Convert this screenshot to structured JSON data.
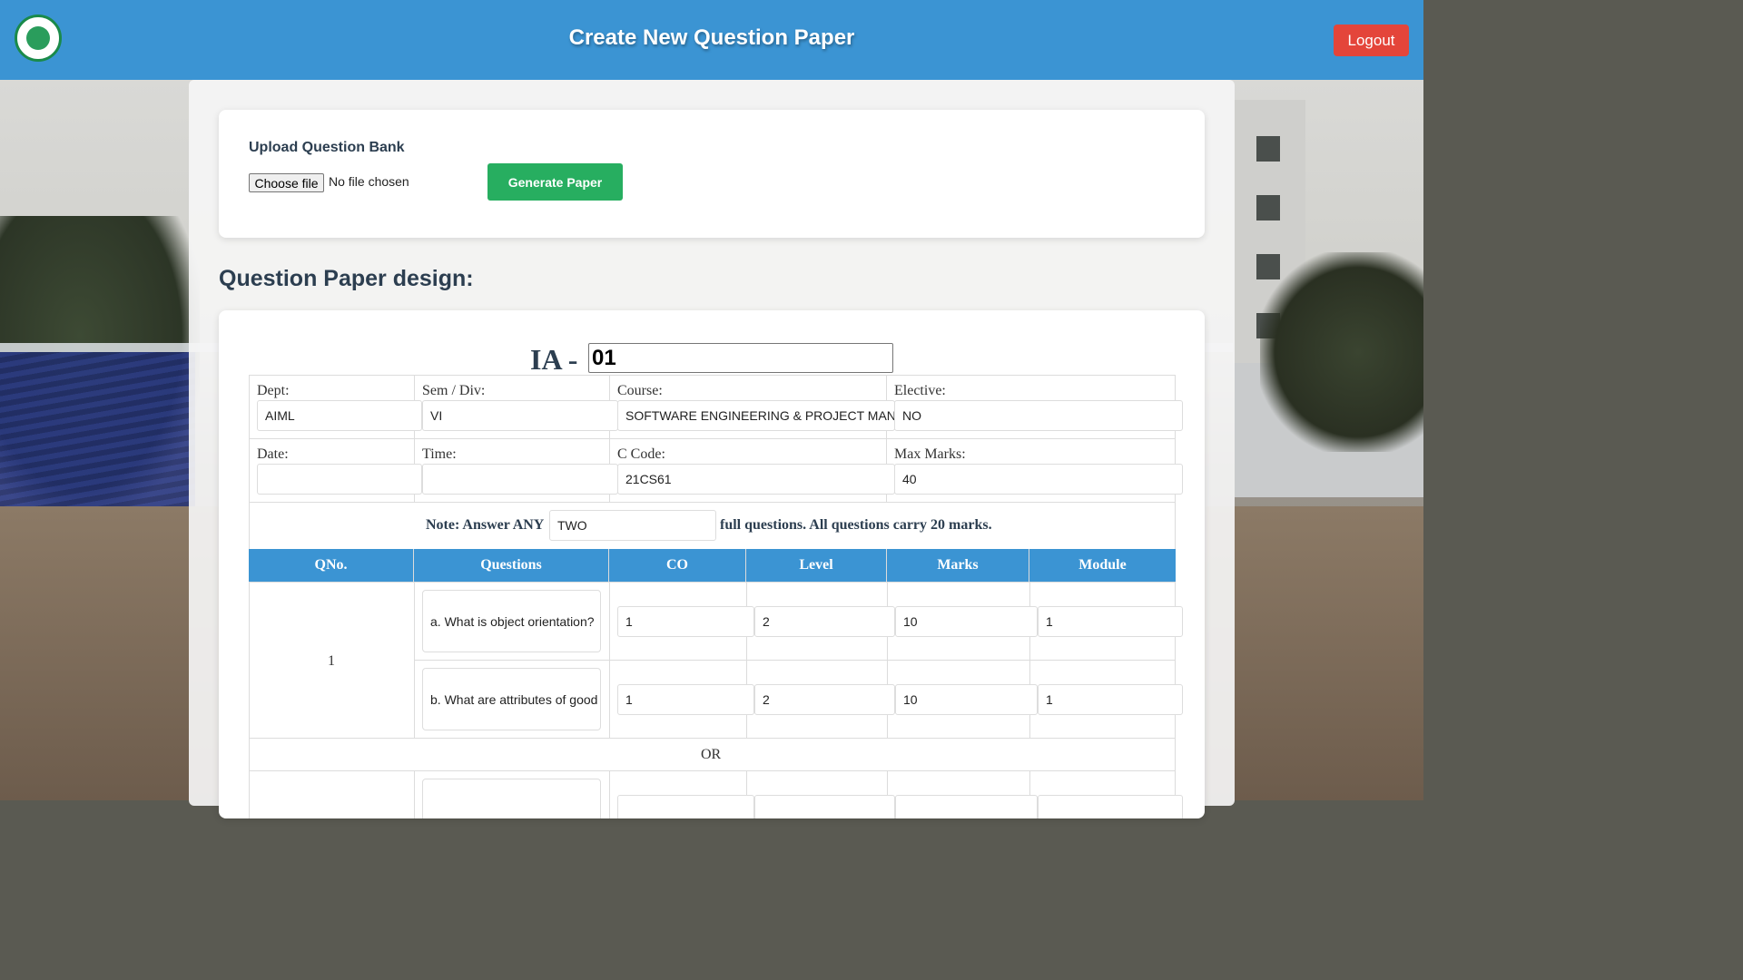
{
  "header": {
    "title": "Create New Question Paper",
    "logout_label": "Logout",
    "accent_color": "#3b94d3",
    "logout_color": "#e4453a"
  },
  "upload": {
    "title": "Upload Question Bank",
    "choose_file_label": "Choose file",
    "file_status": "No file chosen",
    "generate_label": "Generate Paper",
    "generate_color": "#27ae60"
  },
  "design": {
    "heading": "Question Paper design:",
    "ia_label": "IA -",
    "ia_value": "01",
    "fields": {
      "dept_label": "Dept:",
      "dept_value": "AIML",
      "sem_label": "Sem / Div:",
      "sem_value": "VI",
      "course_label": "Course:",
      "course_value": "SOFTWARE ENGINEERING & PROJECT MAN",
      "elective_label": "Elective:",
      "elective_value": "NO",
      "date_label": "Date:",
      "date_value": "",
      "time_label": "Time:",
      "time_value": "",
      "ccode_label": "C Code:",
      "ccode_value": "21CS61",
      "maxmarks_label": "Max Marks:",
      "maxmarks_value": "40"
    },
    "note_prefix": "Note: Answer ANY",
    "note_value": "TWO",
    "note_suffix": "full questions. All questions carry 20 marks.",
    "columns": [
      "QNo.",
      "Questions",
      "CO",
      "Level",
      "Marks",
      "Module"
    ],
    "questions": [
      {
        "qno": "1",
        "parts": [
          {
            "text": "a. What is object orientation?",
            "co": "1",
            "level": "2",
            "marks": "10",
            "module": "1"
          },
          {
            "text": "b. What are attributes of good",
            "co": "1",
            "level": "2",
            "marks": "10",
            "module": "1"
          }
        ]
      }
    ],
    "or_label": "OR"
  }
}
